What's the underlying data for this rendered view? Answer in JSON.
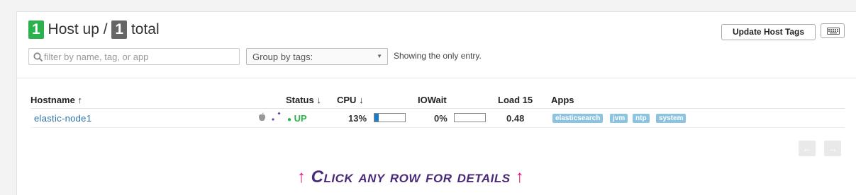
{
  "summary": {
    "up_count": "1",
    "up_label": "Host up /",
    "total_count": "1",
    "total_label": "total"
  },
  "toolbar": {
    "search_placeholder": "filter by name, tag, or app",
    "group_label": "Group by tags:",
    "showing_text": "Showing the only entry.",
    "update_button": "Update Host Tags",
    "keyboard_icon": "keyboard-icon"
  },
  "table": {
    "headers": {
      "hostname": "Hostname",
      "status": "Status",
      "cpu": "CPU",
      "iowait": "IOWait",
      "load15": "Load 15",
      "apps": "Apps"
    },
    "rows": [
      {
        "hostname": "elastic-node1",
        "status": "UP",
        "cpu": "13%",
        "cpu_fraction": 0.13,
        "iowait": "0%",
        "iowait_fraction": 0.0,
        "load15": "0.48",
        "apps": [
          "elasticsearch",
          "jvm",
          "ntp",
          "system"
        ]
      }
    ]
  },
  "hint": {
    "text": "Click any row for details"
  },
  "colors": {
    "up_green": "#2bb24c",
    "bar_blue": "#1f7ac4",
    "tag_blue": "#8cc4e0",
    "hint_purple": "#4a2a7a",
    "hint_arrow_pink": "#e0117f"
  }
}
